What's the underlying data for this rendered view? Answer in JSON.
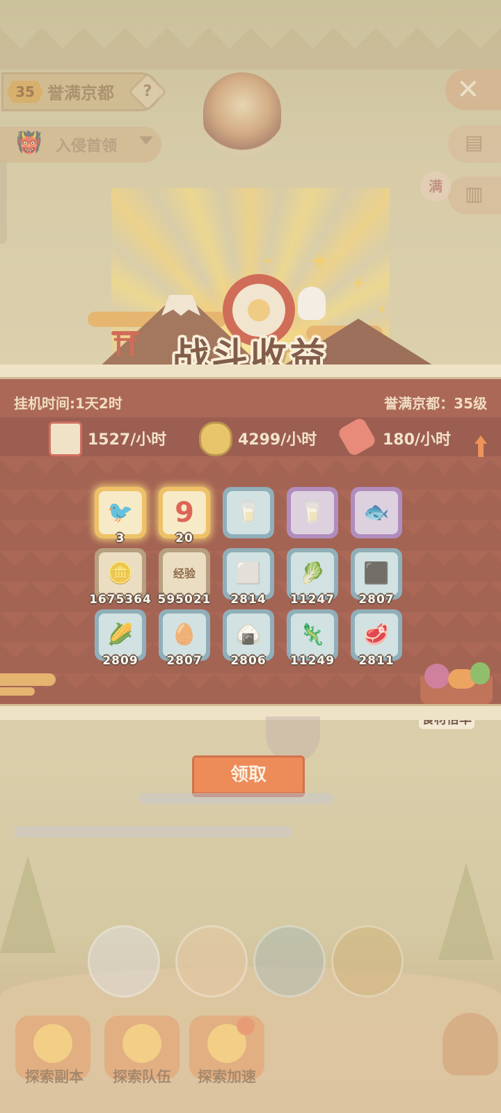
{
  "hud": {
    "level": "35",
    "stage_name": "誉满京都",
    "help_symbol": "?",
    "boss_label": "入侵首领",
    "close_symbol": "✕",
    "man_badge": "满"
  },
  "header": {
    "title": "战斗收益"
  },
  "panel": {
    "afk_time": "挂机时间:1天2时",
    "stage_level": "誉满京都：35级",
    "rates": [
      {
        "icon": "exp-scroll-icon",
        "value": "1527/小时"
      },
      {
        "icon": "coin-icon",
        "value": "4299/小时"
      },
      {
        "icon": "candy-icon",
        "value": "180/小时"
      }
    ],
    "items": [
      {
        "name": "blue-bird-item",
        "count": "3",
        "rarity": "gold",
        "glyph": "🐦"
      },
      {
        "name": "red-nine-item",
        "count": "20",
        "rarity": "gold",
        "glyph": "9"
      },
      {
        "name": "milk-carton-blue-item",
        "count": "",
        "rarity": "blue",
        "glyph": "🥛"
      },
      {
        "name": "milk-carton-orange-item",
        "count": "",
        "rarity": "purple",
        "glyph": "🥛"
      },
      {
        "name": "fish-item",
        "count": "",
        "rarity": "purple",
        "glyph": "🐟"
      },
      {
        "name": "coin-item",
        "count": "1675364",
        "rarity": "brown",
        "glyph": "🪙"
      },
      {
        "name": "exp-scroll-item",
        "count": "595021",
        "rarity": "brown",
        "glyph": "经验"
      },
      {
        "name": "tofu-item",
        "count": "2814",
        "rarity": "blue",
        "glyph": "⬜"
      },
      {
        "name": "greens-item",
        "count": "11247",
        "rarity": "blue",
        "glyph": "🥬"
      },
      {
        "name": "seaweed-item",
        "count": "2807",
        "rarity": "blue",
        "glyph": "⬛"
      },
      {
        "name": "corn-item",
        "count": "2809",
        "rarity": "blue",
        "glyph": "🌽"
      },
      {
        "name": "egg-item",
        "count": "2807",
        "rarity": "blue",
        "glyph": "🥚"
      },
      {
        "name": "rice-item",
        "count": "2806",
        "rarity": "blue",
        "glyph": "🍙"
      },
      {
        "name": "eel-item",
        "count": "11249",
        "rarity": "blue",
        "glyph": "🦎"
      },
      {
        "name": "meat-item",
        "count": "2811",
        "rarity": "blue",
        "glyph": "🥩"
      }
    ],
    "food_rate_label": "食材倍率",
    "claim_label": "领取"
  },
  "bottom": {
    "explore": [
      {
        "label": "探索副本"
      },
      {
        "label": "探索队伍"
      },
      {
        "label": "探索加速"
      }
    ]
  },
  "colors": {
    "panel": "#943a2c",
    "claim_button": "#ef6a2e",
    "title_text": "#5a2a1a"
  }
}
